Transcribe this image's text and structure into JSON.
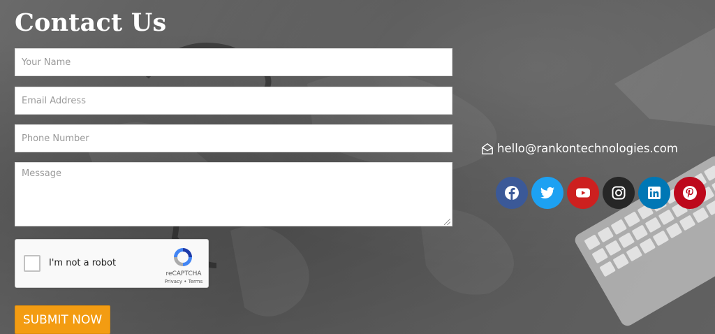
{
  "heading": "Contact Us",
  "form": {
    "name_placeholder": "Your Name",
    "email_placeholder": "Email Address",
    "phone_placeholder": "Phone Number",
    "message_placeholder": "Message",
    "submit_label": "SUBMIT NOW"
  },
  "captcha": {
    "label": "I'm not a robot",
    "brand": "reCAPTCHA",
    "legal": "Privacy • Terms"
  },
  "contact": {
    "email": "hello@rankontechnologies.com",
    "icon": "envelope-open-icon"
  },
  "social": [
    {
      "name": "facebook",
      "icon": "facebook-icon",
      "color": "#3b5998"
    },
    {
      "name": "twitter",
      "icon": "twitter-icon",
      "color": "#1da1f2"
    },
    {
      "name": "youtube",
      "icon": "youtube-icon",
      "color": "#cd201f"
    },
    {
      "name": "instagram",
      "icon": "instagram-icon",
      "color": "#262626"
    },
    {
      "name": "linkedin",
      "icon": "linkedin-icon",
      "color": "#0077b5"
    },
    {
      "name": "pinterest",
      "icon": "pinterest-icon",
      "color": "#bd081c"
    }
  ],
  "colors": {
    "accent": "#f39c12",
    "text_light": "#ffffff",
    "background": "#5e5e5e"
  }
}
